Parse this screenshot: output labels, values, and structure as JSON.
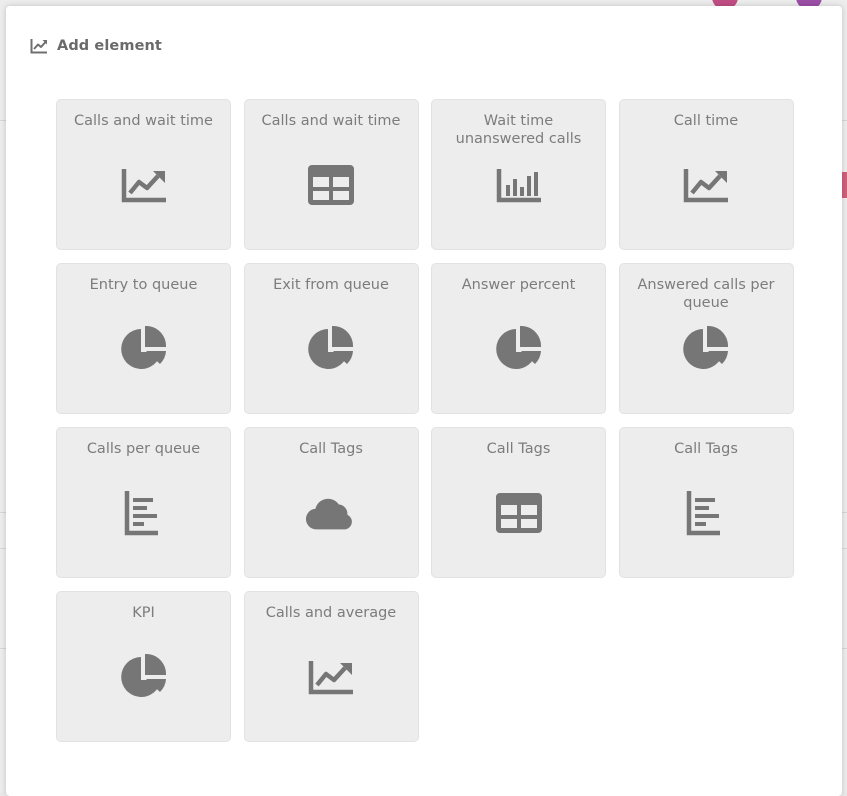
{
  "dialog": {
    "title": "Add element",
    "title_icon": "line-chart-icon"
  },
  "colors": {
    "tile_background": "#ededed",
    "icon": "#767676",
    "label": "#7c7c7c"
  },
  "tiles": [
    {
      "label": "Calls and wait time",
      "icon": "line-chart-icon"
    },
    {
      "label": "Calls and wait time",
      "icon": "table-icon"
    },
    {
      "label": "Wait time unanswered calls",
      "icon": "bar-chart-icon"
    },
    {
      "label": "Call time",
      "icon": "line-chart-icon"
    },
    {
      "label": "Entry to queue",
      "icon": "pie-chart-icon"
    },
    {
      "label": "Exit from queue",
      "icon": "pie-chart-icon"
    },
    {
      "label": "Answer percent",
      "icon": "pie-chart-icon"
    },
    {
      "label": "Answered calls per queue",
      "icon": "pie-chart-icon"
    },
    {
      "label": "Calls per queue",
      "icon": "horizontal-bar-chart-icon"
    },
    {
      "label": "Call Tags",
      "icon": "cloud-icon"
    },
    {
      "label": "Call Tags",
      "icon": "table-icon"
    },
    {
      "label": "Call Tags",
      "icon": "horizontal-bar-chart-icon"
    },
    {
      "label": "KPI",
      "icon": "pie-chart-icon"
    },
    {
      "label": "Calls and average",
      "icon": "line-chart-icon"
    }
  ]
}
